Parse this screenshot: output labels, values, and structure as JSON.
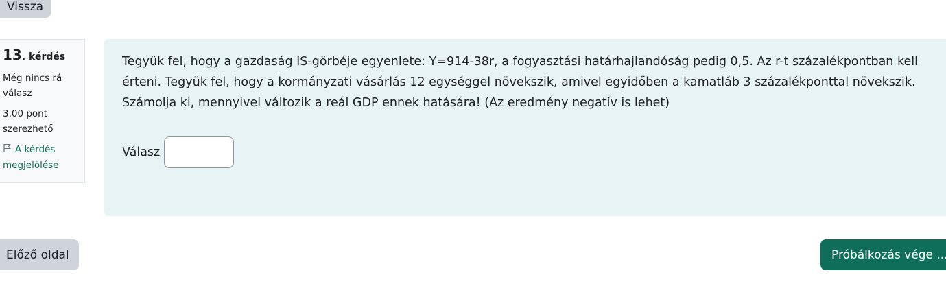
{
  "nav": {
    "back_label": "Vissza",
    "prev_label": "Előző oldal",
    "finish_label": "Próbálkozás vége ..."
  },
  "question_info": {
    "number": "13",
    "number_suffix": ". kérdés",
    "state": "Még nincs rá válasz",
    "grade": "3,00 pont szerezhető",
    "flag_label": "A kérdés megjelölése",
    "flag_icon": "flag-icon"
  },
  "question": {
    "text": "Tegyük fel, hogy a gazdaság IS-görbéje egyenlete: Y=914-38r, a fogyasztási határhajlandóság pedig 0,5. Az r-t százalékpontban kell érteni. Tegyük fel, hogy a kormányzati vásárlás 12 egységgel növekszik, amivel egyidőben a kamatláb 3 százalékponttal növekszik. Számolja ki, mennyivel változik a reál GDP ennek hatására! (Az eredmény negatív is lehet)",
    "answer_label": "Válasz",
    "answer_value": ""
  },
  "colors": {
    "content_bg": "#e7f3f5",
    "primary": "#0f6e5a",
    "secondary": "#ced4da"
  }
}
